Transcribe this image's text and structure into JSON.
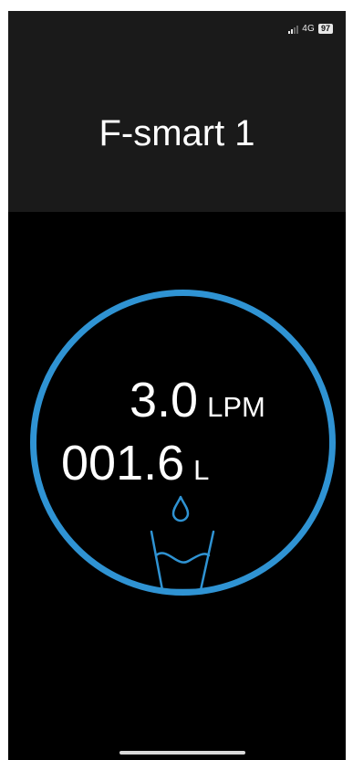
{
  "status_bar": {
    "network": "4G",
    "battery": "97"
  },
  "header": {
    "title": "F-smart 1"
  },
  "gauge": {
    "flow_rate": "3.0",
    "flow_unit": "LPM",
    "volume": "001.6",
    "volume_unit": "L",
    "accent_color": "#2f93d3"
  },
  "icons": {
    "drop": "water-drop-icon",
    "glass": "water-glass-icon"
  }
}
